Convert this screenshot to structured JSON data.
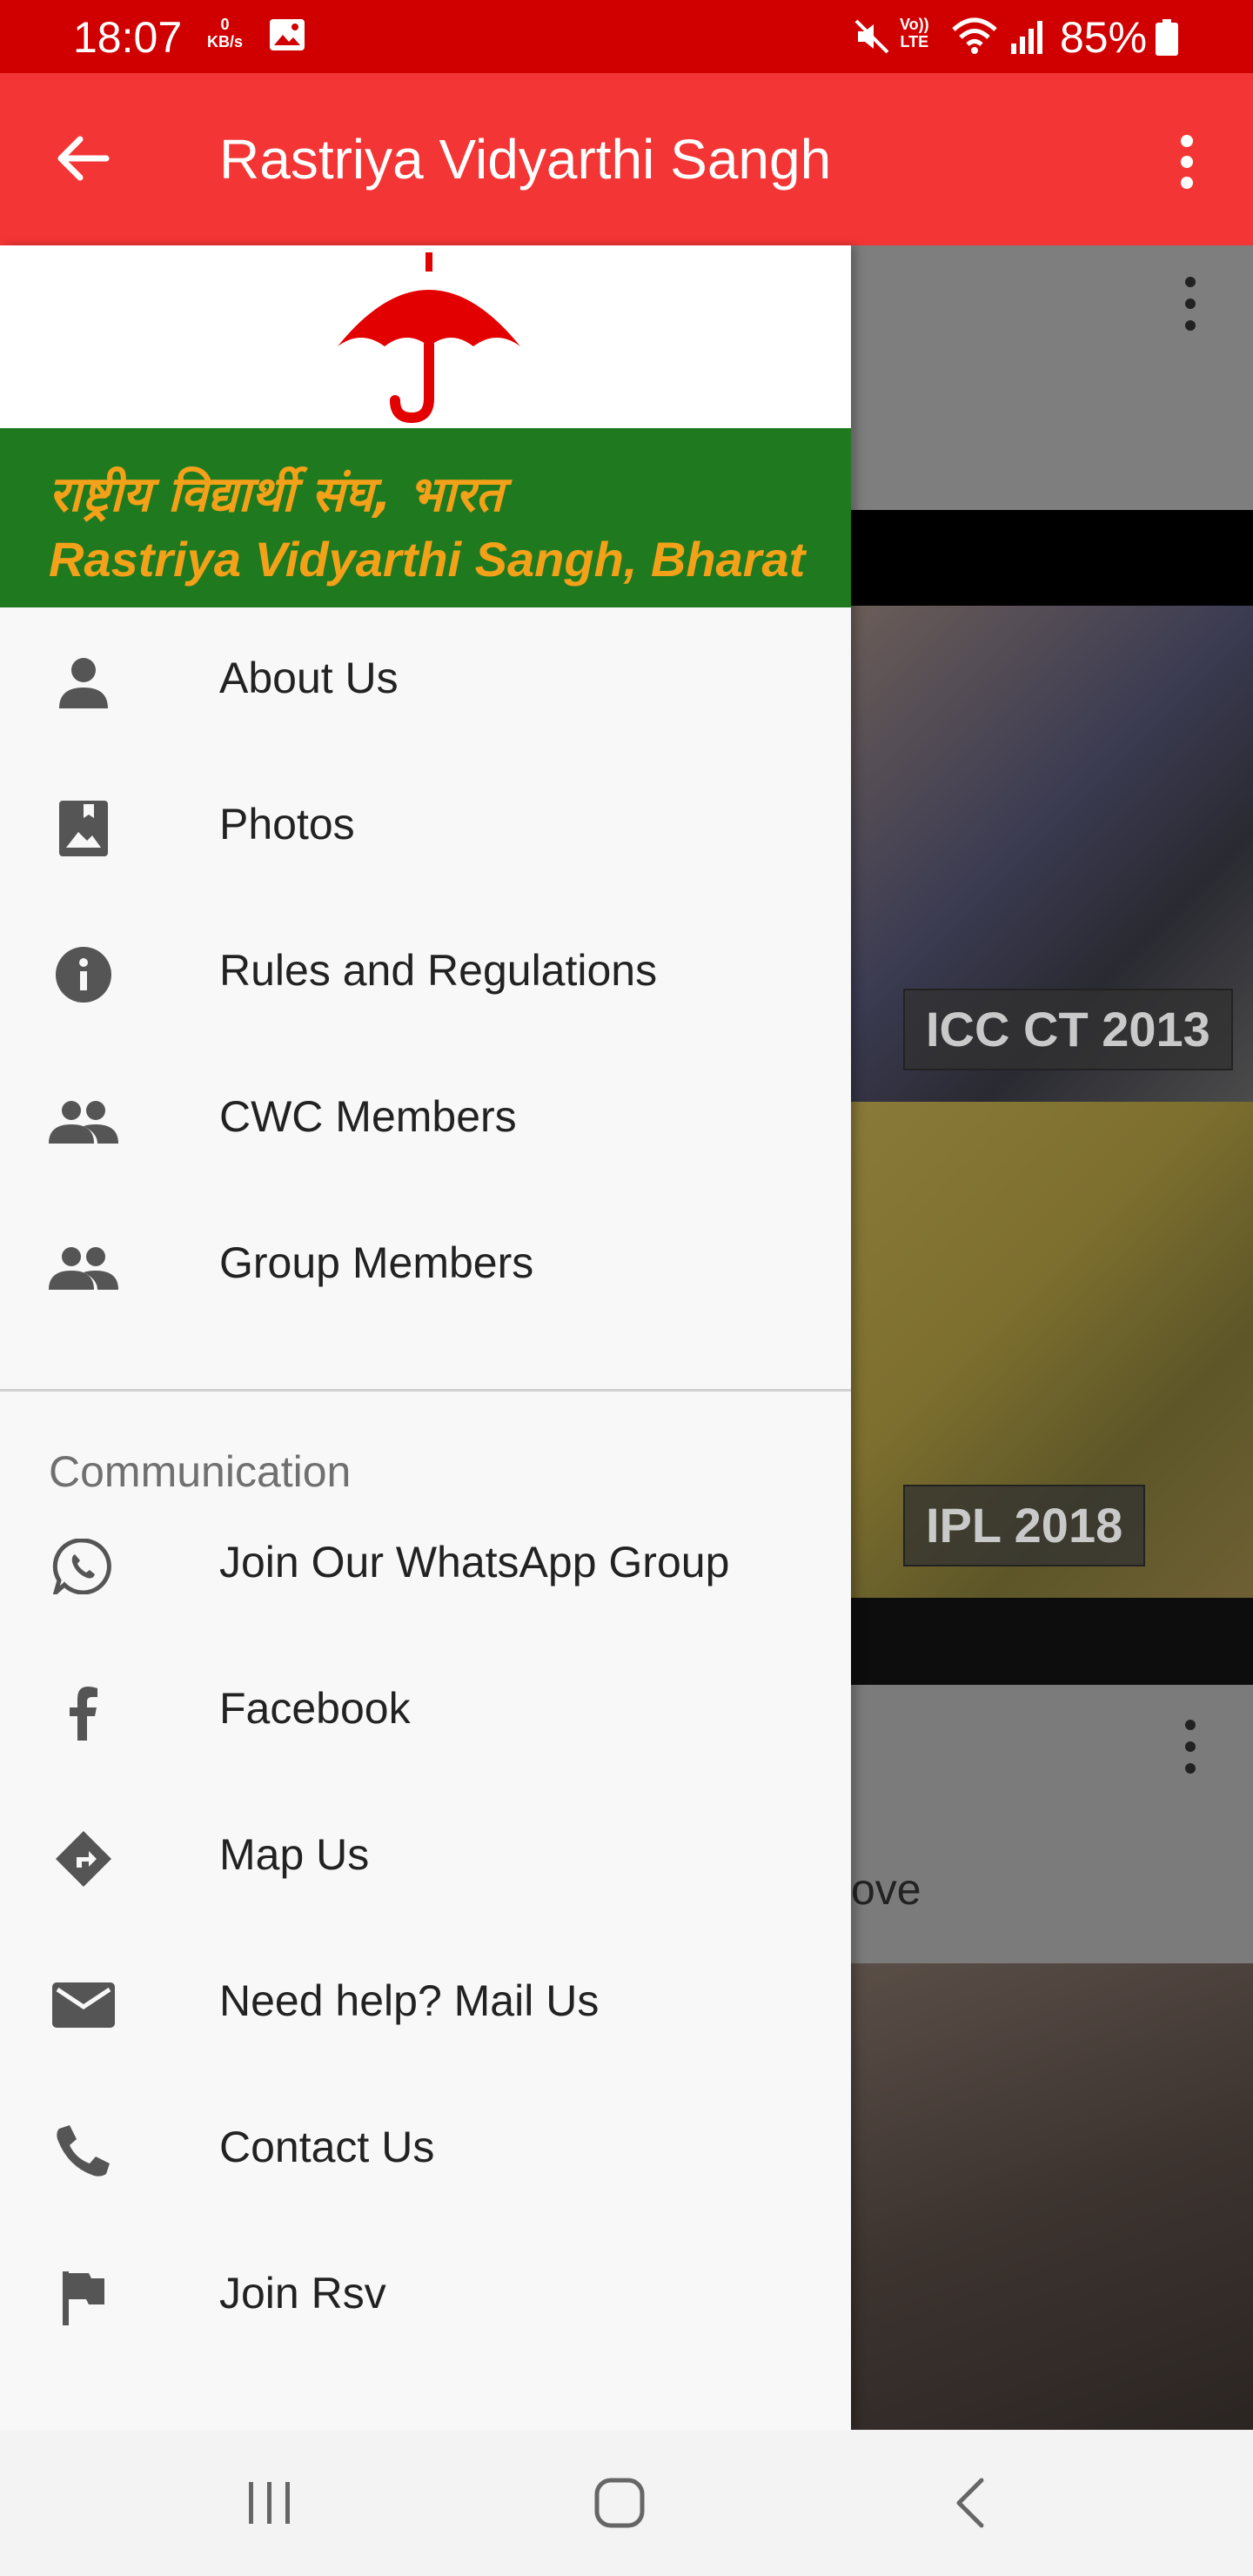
{
  "status_bar": {
    "time": "18:07",
    "net_speed_value": "0",
    "net_speed_unit": "KB/s",
    "volte_top": "Vo))",
    "volte_bottom": "LTE",
    "battery": "85%"
  },
  "app_bar": {
    "title": "Rastriya Vidyarthi Sangh",
    "color": "#f43535"
  },
  "drawer": {
    "banner_hindi": "राष्ट्रीय विद्यार्थी संघ, भारत",
    "banner_english": "Rastriya Vidyarthi Sangh, Bharat",
    "banner_color": "#1f7a1f",
    "accent": "#f4a11a",
    "items": [
      {
        "label": "About Us",
        "icon": "person-icon"
      },
      {
        "label": "Photos",
        "icon": "photo-icon"
      },
      {
        "label": "Rules and Regulations",
        "icon": "info-icon"
      },
      {
        "label": "CWC Members",
        "icon": "group-icon"
      },
      {
        "label": "Group Members",
        "icon": "group-icon"
      }
    ],
    "section_header": "Communication",
    "comm_items": [
      {
        "label": "Join Our WhatsApp Group",
        "icon": "whatsapp-icon"
      },
      {
        "label": "Facebook",
        "icon": "facebook-icon"
      },
      {
        "label": "Map Us",
        "icon": "directions-icon"
      },
      {
        "label": "Need help? Mail Us",
        "icon": "mail-icon"
      },
      {
        "label": "Contact Us",
        "icon": "phone-icon"
      },
      {
        "label": "Join Rsv",
        "icon": "flag-icon"
      }
    ]
  },
  "background": {
    "caption_1": "ICC CT 2013",
    "caption_2": "IPL 2018",
    "partial_text": "ove"
  }
}
